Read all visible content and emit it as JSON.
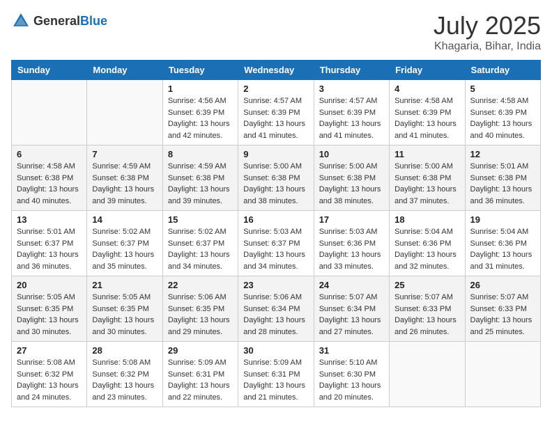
{
  "header": {
    "logo_general": "General",
    "logo_blue": "Blue",
    "month": "July 2025",
    "location": "Khagaria, Bihar, India"
  },
  "weekdays": [
    "Sunday",
    "Monday",
    "Tuesday",
    "Wednesday",
    "Thursday",
    "Friday",
    "Saturday"
  ],
  "weeks": [
    [
      {
        "day": "",
        "info": ""
      },
      {
        "day": "",
        "info": ""
      },
      {
        "day": "1",
        "info": "Sunrise: 4:56 AM\nSunset: 6:39 PM\nDaylight: 13 hours and 42 minutes."
      },
      {
        "day": "2",
        "info": "Sunrise: 4:57 AM\nSunset: 6:39 PM\nDaylight: 13 hours and 41 minutes."
      },
      {
        "day": "3",
        "info": "Sunrise: 4:57 AM\nSunset: 6:39 PM\nDaylight: 13 hours and 41 minutes."
      },
      {
        "day": "4",
        "info": "Sunrise: 4:58 AM\nSunset: 6:39 PM\nDaylight: 13 hours and 41 minutes."
      },
      {
        "day": "5",
        "info": "Sunrise: 4:58 AM\nSunset: 6:39 PM\nDaylight: 13 hours and 40 minutes."
      }
    ],
    [
      {
        "day": "6",
        "info": "Sunrise: 4:58 AM\nSunset: 6:38 PM\nDaylight: 13 hours and 40 minutes."
      },
      {
        "day": "7",
        "info": "Sunrise: 4:59 AM\nSunset: 6:38 PM\nDaylight: 13 hours and 39 minutes."
      },
      {
        "day": "8",
        "info": "Sunrise: 4:59 AM\nSunset: 6:38 PM\nDaylight: 13 hours and 39 minutes."
      },
      {
        "day": "9",
        "info": "Sunrise: 5:00 AM\nSunset: 6:38 PM\nDaylight: 13 hours and 38 minutes."
      },
      {
        "day": "10",
        "info": "Sunrise: 5:00 AM\nSunset: 6:38 PM\nDaylight: 13 hours and 38 minutes."
      },
      {
        "day": "11",
        "info": "Sunrise: 5:00 AM\nSunset: 6:38 PM\nDaylight: 13 hours and 37 minutes."
      },
      {
        "day": "12",
        "info": "Sunrise: 5:01 AM\nSunset: 6:38 PM\nDaylight: 13 hours and 36 minutes."
      }
    ],
    [
      {
        "day": "13",
        "info": "Sunrise: 5:01 AM\nSunset: 6:37 PM\nDaylight: 13 hours and 36 minutes."
      },
      {
        "day": "14",
        "info": "Sunrise: 5:02 AM\nSunset: 6:37 PM\nDaylight: 13 hours and 35 minutes."
      },
      {
        "day": "15",
        "info": "Sunrise: 5:02 AM\nSunset: 6:37 PM\nDaylight: 13 hours and 34 minutes."
      },
      {
        "day": "16",
        "info": "Sunrise: 5:03 AM\nSunset: 6:37 PM\nDaylight: 13 hours and 34 minutes."
      },
      {
        "day": "17",
        "info": "Sunrise: 5:03 AM\nSunset: 6:36 PM\nDaylight: 13 hours and 33 minutes."
      },
      {
        "day": "18",
        "info": "Sunrise: 5:04 AM\nSunset: 6:36 PM\nDaylight: 13 hours and 32 minutes."
      },
      {
        "day": "19",
        "info": "Sunrise: 5:04 AM\nSunset: 6:36 PM\nDaylight: 13 hours and 31 minutes."
      }
    ],
    [
      {
        "day": "20",
        "info": "Sunrise: 5:05 AM\nSunset: 6:35 PM\nDaylight: 13 hours and 30 minutes."
      },
      {
        "day": "21",
        "info": "Sunrise: 5:05 AM\nSunset: 6:35 PM\nDaylight: 13 hours and 30 minutes."
      },
      {
        "day": "22",
        "info": "Sunrise: 5:06 AM\nSunset: 6:35 PM\nDaylight: 13 hours and 29 minutes."
      },
      {
        "day": "23",
        "info": "Sunrise: 5:06 AM\nSunset: 6:34 PM\nDaylight: 13 hours and 28 minutes."
      },
      {
        "day": "24",
        "info": "Sunrise: 5:07 AM\nSunset: 6:34 PM\nDaylight: 13 hours and 27 minutes."
      },
      {
        "day": "25",
        "info": "Sunrise: 5:07 AM\nSunset: 6:33 PM\nDaylight: 13 hours and 26 minutes."
      },
      {
        "day": "26",
        "info": "Sunrise: 5:07 AM\nSunset: 6:33 PM\nDaylight: 13 hours and 25 minutes."
      }
    ],
    [
      {
        "day": "27",
        "info": "Sunrise: 5:08 AM\nSunset: 6:32 PM\nDaylight: 13 hours and 24 minutes."
      },
      {
        "day": "28",
        "info": "Sunrise: 5:08 AM\nSunset: 6:32 PM\nDaylight: 13 hours and 23 minutes."
      },
      {
        "day": "29",
        "info": "Sunrise: 5:09 AM\nSunset: 6:31 PM\nDaylight: 13 hours and 22 minutes."
      },
      {
        "day": "30",
        "info": "Sunrise: 5:09 AM\nSunset: 6:31 PM\nDaylight: 13 hours and 21 minutes."
      },
      {
        "day": "31",
        "info": "Sunrise: 5:10 AM\nSunset: 6:30 PM\nDaylight: 13 hours and 20 minutes."
      },
      {
        "day": "",
        "info": ""
      },
      {
        "day": "",
        "info": ""
      }
    ]
  ]
}
